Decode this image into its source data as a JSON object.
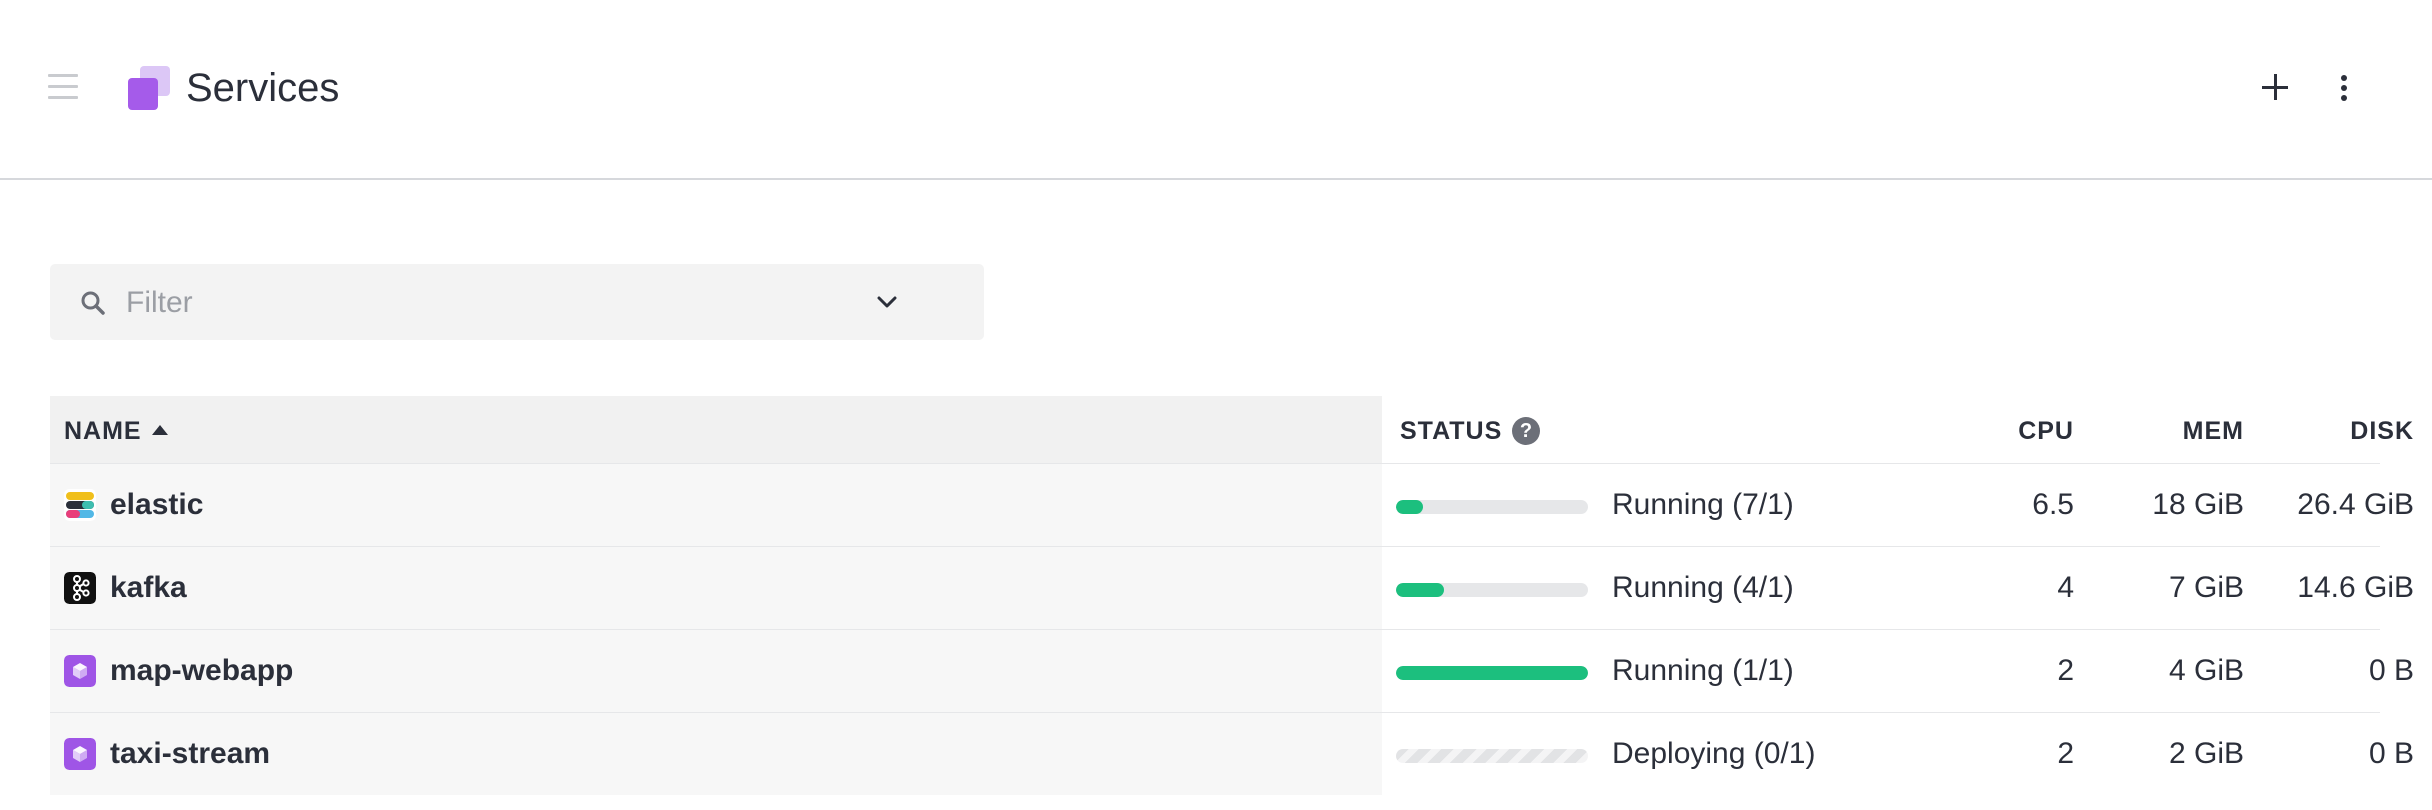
{
  "header": {
    "title": "Services",
    "menu_icon": "hamburger-menu-icon",
    "logo_icon": "services-cube-icon",
    "add_icon": "plus-icon",
    "more_icon": "vertical-dots-icon"
  },
  "filter": {
    "placeholder": "Filter",
    "value": "",
    "search_icon": "search-icon",
    "dropdown_icon": "chevron-down-icon"
  },
  "table": {
    "columns": {
      "name": "NAME",
      "status": "STATUS",
      "cpu": "CPU",
      "mem": "MEM",
      "disk": "DISK"
    },
    "sort": {
      "column": "name",
      "direction": "ascending"
    },
    "rows": [
      {
        "name": "elastic",
        "icon": "elastic-icon",
        "status": "Running (7/1)",
        "status_progress": 0.14,
        "bar_style": "solid",
        "cpu": "6.5",
        "mem": "18 GiB",
        "disk": "26.4 GiB"
      },
      {
        "name": "kafka",
        "icon": "kafka-icon",
        "status": "Running (4/1)",
        "status_progress": 0.25,
        "bar_style": "solid",
        "cpu": "4",
        "mem": "7 GiB",
        "disk": "14.6 GiB"
      },
      {
        "name": "map-webapp",
        "icon": "service-cube-icon",
        "status": "Running (1/1)",
        "status_progress": 1.0,
        "bar_style": "solid",
        "cpu": "2",
        "mem": "4 GiB",
        "disk": "0 B"
      },
      {
        "name": "taxi-stream",
        "icon": "service-cube-icon",
        "status": "Deploying (0/1)",
        "status_progress": 0.0,
        "bar_style": "striped",
        "cpu": "2",
        "mem": "2 GiB",
        "disk": "0 B"
      }
    ]
  },
  "colors": {
    "accent_purple": "#a55bea",
    "success_green": "#1cbf7e",
    "text": "#2b2f3a",
    "muted": "#9b9ea4"
  }
}
